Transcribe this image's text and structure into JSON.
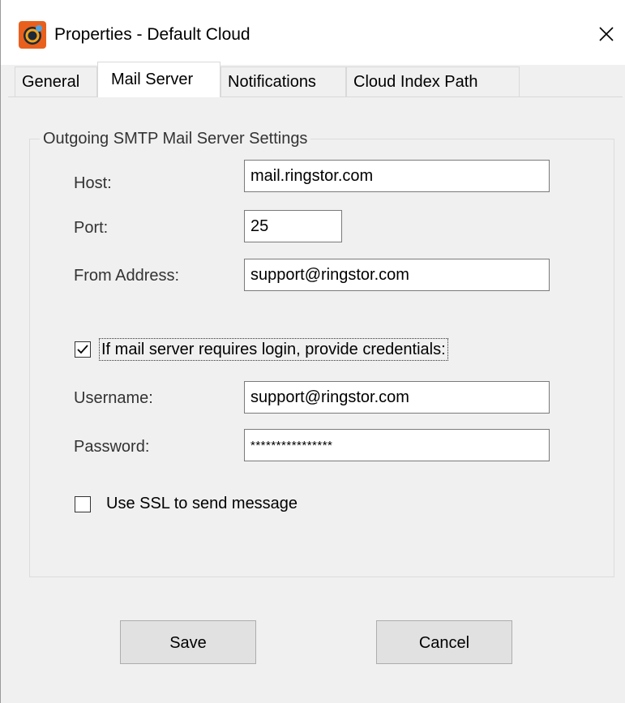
{
  "window": {
    "title": "Properties - Default Cloud",
    "icon": "app-cloud-icon",
    "close_icon": "close-icon"
  },
  "tabs": [
    {
      "label": "General",
      "active": false
    },
    {
      "label": "Mail Server",
      "active": true
    },
    {
      "label": "Notifications",
      "active": false
    },
    {
      "label": "Cloud Index Path",
      "active": false
    }
  ],
  "smtp": {
    "group_title": "Outgoing SMTP Mail Server Settings",
    "host_label": "Host:",
    "host_value": "mail.ringstor.com",
    "port_label": "Port:",
    "port_value": "25",
    "from_label": "From Address:",
    "from_value": "support@ringstor.com",
    "login_checkbox_label": "If mail server requires login, provide credentials:",
    "login_checked": true,
    "username_label": "Username:",
    "username_value": "support@ringstor.com",
    "password_label": "Password:",
    "password_value": "****************",
    "ssl_checkbox_label": "Use SSL to send message",
    "ssl_checked": false
  },
  "buttons": {
    "save": "Save",
    "cancel": "Cancel"
  },
  "colors": {
    "icon_orange": "#e8601c",
    "window_bg": "#f0f0f0",
    "field_border": "#7a7a7a"
  }
}
